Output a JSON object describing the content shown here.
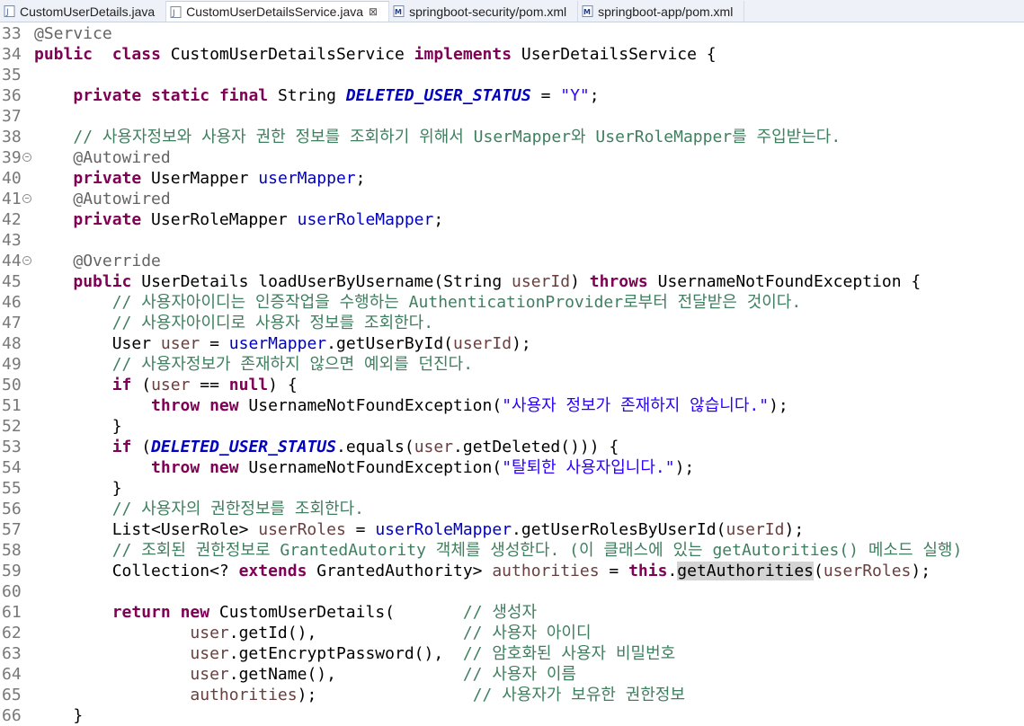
{
  "tabs": [
    {
      "label": "CustomUserDetails.java",
      "icon": "java-file-icon",
      "active": false
    },
    {
      "label": "CustomUserDetailsService.java",
      "icon": "java-file-icon",
      "active": true
    },
    {
      "label": "springboot-security/pom.xml",
      "icon": "maven-file-icon",
      "active": false
    },
    {
      "label": "springboot-app/pom.xml",
      "icon": "maven-file-icon",
      "active": false
    }
  ],
  "close_glyph": "⊠",
  "lines": [
    {
      "n": "33",
      "fold": false,
      "t": [
        [
          "ann",
          "@Service"
        ]
      ]
    },
    {
      "n": "34",
      "fold": false,
      "t": [
        [
          "kw",
          "public"
        ],
        [
          "",
          "  "
        ],
        [
          "kw",
          "class"
        ],
        [
          "",
          " CustomUserDetailsService "
        ],
        [
          "kw",
          "implements"
        ],
        [
          "",
          " UserDetailsService {"
        ]
      ]
    },
    {
      "n": "35",
      "fold": false,
      "t": []
    },
    {
      "n": "36",
      "fold": false,
      "t": [
        [
          "",
          "    "
        ],
        [
          "kw",
          "private"
        ],
        [
          "",
          " "
        ],
        [
          "kw",
          "static"
        ],
        [
          "",
          " "
        ],
        [
          "kw",
          "final"
        ],
        [
          "",
          " String "
        ],
        [
          "sfld",
          "DELETED_USER_STATUS"
        ],
        [
          "",
          " = "
        ],
        [
          "str",
          "\"Y\""
        ],
        [
          "",
          ";"
        ]
      ]
    },
    {
      "n": "37",
      "fold": false,
      "t": []
    },
    {
      "n": "38",
      "fold": false,
      "t": [
        [
          "",
          "    "
        ],
        [
          "cm",
          "// 사용자정보와 사용자 권한 정보를 조회하기 위해서 UserMapper와 UserRoleMapper를 주입받는다."
        ]
      ]
    },
    {
      "n": "39",
      "fold": true,
      "t": [
        [
          "",
          "    "
        ],
        [
          "ann",
          "@Autowired"
        ]
      ]
    },
    {
      "n": "40",
      "fold": false,
      "t": [
        [
          "",
          "    "
        ],
        [
          "kw",
          "private"
        ],
        [
          "",
          " UserMapper "
        ],
        [
          "fld",
          "userMapper"
        ],
        [
          "",
          ";"
        ]
      ]
    },
    {
      "n": "41",
      "fold": true,
      "t": [
        [
          "",
          "    "
        ],
        [
          "ann",
          "@Autowired"
        ]
      ]
    },
    {
      "n": "42",
      "fold": false,
      "t": [
        [
          "",
          "    "
        ],
        [
          "kw",
          "private"
        ],
        [
          "",
          " UserRoleMapper "
        ],
        [
          "fld",
          "userRoleMapper"
        ],
        [
          "",
          ";"
        ]
      ]
    },
    {
      "n": "43",
      "fold": false,
      "t": []
    },
    {
      "n": "44",
      "fold": true,
      "t": [
        [
          "",
          "    "
        ],
        [
          "ann",
          "@Override"
        ]
      ]
    },
    {
      "n": "45",
      "fold": false,
      "t": [
        [
          "",
          "    "
        ],
        [
          "kw",
          "public"
        ],
        [
          "",
          " UserDetails loadUserByUsername(String "
        ],
        [
          "var",
          "userId"
        ],
        [
          "",
          ") "
        ],
        [
          "kw",
          "throws"
        ],
        [
          "",
          " UsernameNotFoundException {"
        ]
      ]
    },
    {
      "n": "46",
      "fold": false,
      "t": [
        [
          "",
          "        "
        ],
        [
          "cm",
          "// 사용자아이디는 인증작업을 수행하는 AuthenticationProvider로부터 전달받은 것이다."
        ]
      ]
    },
    {
      "n": "47",
      "fold": false,
      "t": [
        [
          "",
          "        "
        ],
        [
          "cm",
          "// 사용자아이디로 사용자 정보를 조회한다."
        ]
      ]
    },
    {
      "n": "48",
      "fold": false,
      "t": [
        [
          "",
          "        User "
        ],
        [
          "var",
          "user"
        ],
        [
          "",
          " = "
        ],
        [
          "fld",
          "userMapper"
        ],
        [
          "",
          ".getUserById("
        ],
        [
          "var",
          "userId"
        ],
        [
          "",
          ");"
        ]
      ]
    },
    {
      "n": "49",
      "fold": false,
      "t": [
        [
          "",
          "        "
        ],
        [
          "cm",
          "// 사용자정보가 존재하지 않으면 예외를 던진다."
        ]
      ]
    },
    {
      "n": "50",
      "fold": false,
      "t": [
        [
          "",
          "        "
        ],
        [
          "kw",
          "if"
        ],
        [
          "",
          " ("
        ],
        [
          "var",
          "user"
        ],
        [
          "",
          " == "
        ],
        [
          "kw",
          "null"
        ],
        [
          "",
          ") {"
        ]
      ]
    },
    {
      "n": "51",
      "fold": false,
      "t": [
        [
          "",
          "            "
        ],
        [
          "kw",
          "throw"
        ],
        [
          "",
          " "
        ],
        [
          "kw",
          "new"
        ],
        [
          "",
          " UsernameNotFoundException("
        ],
        [
          "str",
          "\"사용자 정보가 존재하지 않습니다.\""
        ],
        [
          "",
          ");"
        ]
      ]
    },
    {
      "n": "52",
      "fold": false,
      "t": [
        [
          "",
          "        }"
        ]
      ]
    },
    {
      "n": "53",
      "fold": false,
      "t": [
        [
          "",
          "        "
        ],
        [
          "kw",
          "if"
        ],
        [
          "",
          " ("
        ],
        [
          "sfld",
          "DELETED_USER_STATUS"
        ],
        [
          "",
          ".equals("
        ],
        [
          "var",
          "user"
        ],
        [
          "",
          ".getDeleted())) {"
        ]
      ]
    },
    {
      "n": "54",
      "fold": false,
      "t": [
        [
          "",
          "            "
        ],
        [
          "kw",
          "throw"
        ],
        [
          "",
          " "
        ],
        [
          "kw",
          "new"
        ],
        [
          "",
          " UsernameNotFoundException("
        ],
        [
          "str",
          "\"탈퇴한 사용자입니다.\""
        ],
        [
          "",
          ");"
        ]
      ]
    },
    {
      "n": "55",
      "fold": false,
      "t": [
        [
          "",
          "        }"
        ]
      ]
    },
    {
      "n": "56",
      "fold": false,
      "t": [
        [
          "",
          "        "
        ],
        [
          "cm",
          "// 사용자의 권한정보를 조회한다."
        ]
      ]
    },
    {
      "n": "57",
      "fold": false,
      "t": [
        [
          "",
          "        List<UserRole> "
        ],
        [
          "var",
          "userRoles"
        ],
        [
          "",
          " = "
        ],
        [
          "fld",
          "userRoleMapper"
        ],
        [
          "",
          ".getUserRolesByUserId("
        ],
        [
          "var",
          "userId"
        ],
        [
          "",
          ");"
        ]
      ]
    },
    {
      "n": "58",
      "fold": false,
      "t": [
        [
          "",
          "        "
        ],
        [
          "cm",
          "// 조회된 권한정보로 GrantedAutority 객체를 생성한다. (이 클래스에 있는 getAutorities() 메소드 실행)"
        ]
      ]
    },
    {
      "n": "59",
      "fold": false,
      "t": [
        [
          "",
          "        Collection<? "
        ],
        [
          "kw",
          "extends"
        ],
        [
          "",
          " GrantedAuthority> "
        ],
        [
          "var",
          "authorities"
        ],
        [
          "",
          " = "
        ],
        [
          "kw",
          "this"
        ],
        [
          "",
          "."
        ],
        [
          "hl",
          "getAuthorities"
        ],
        [
          "",
          "("
        ],
        [
          "var",
          "userRoles"
        ],
        [
          "",
          ");"
        ]
      ]
    },
    {
      "n": "60",
      "fold": false,
      "t": []
    },
    {
      "n": "61",
      "fold": false,
      "t": [
        [
          "",
          "        "
        ],
        [
          "kw",
          "return"
        ],
        [
          "",
          " "
        ],
        [
          "kw",
          "new"
        ],
        [
          "",
          " CustomUserDetails(       "
        ],
        [
          "cm",
          "// 생성자"
        ]
      ]
    },
    {
      "n": "62",
      "fold": false,
      "t": [
        [
          "",
          "                "
        ],
        [
          "var",
          "user"
        ],
        [
          "",
          ".getId(),               "
        ],
        [
          "cm",
          "// 사용자 아이디"
        ]
      ]
    },
    {
      "n": "63",
      "fold": false,
      "t": [
        [
          "",
          "                "
        ],
        [
          "var",
          "user"
        ],
        [
          "",
          ".getEncryptPassword(),  "
        ],
        [
          "cm",
          "// 암호화된 사용자 비밀번호"
        ]
      ]
    },
    {
      "n": "64",
      "fold": false,
      "t": [
        [
          "",
          "                "
        ],
        [
          "var",
          "user"
        ],
        [
          "",
          ".getName(),             "
        ],
        [
          "cm",
          "// 사용자 이름"
        ]
      ]
    },
    {
      "n": "65",
      "fold": false,
      "t": [
        [
          "",
          "                "
        ],
        [
          "var",
          "authorities"
        ],
        [
          "",
          ");                "
        ],
        [
          "cm",
          "// 사용자가 보유한 권한정보"
        ]
      ]
    },
    {
      "n": "66",
      "fold": false,
      "t": [
        [
          "",
          "    }"
        ]
      ]
    }
  ]
}
